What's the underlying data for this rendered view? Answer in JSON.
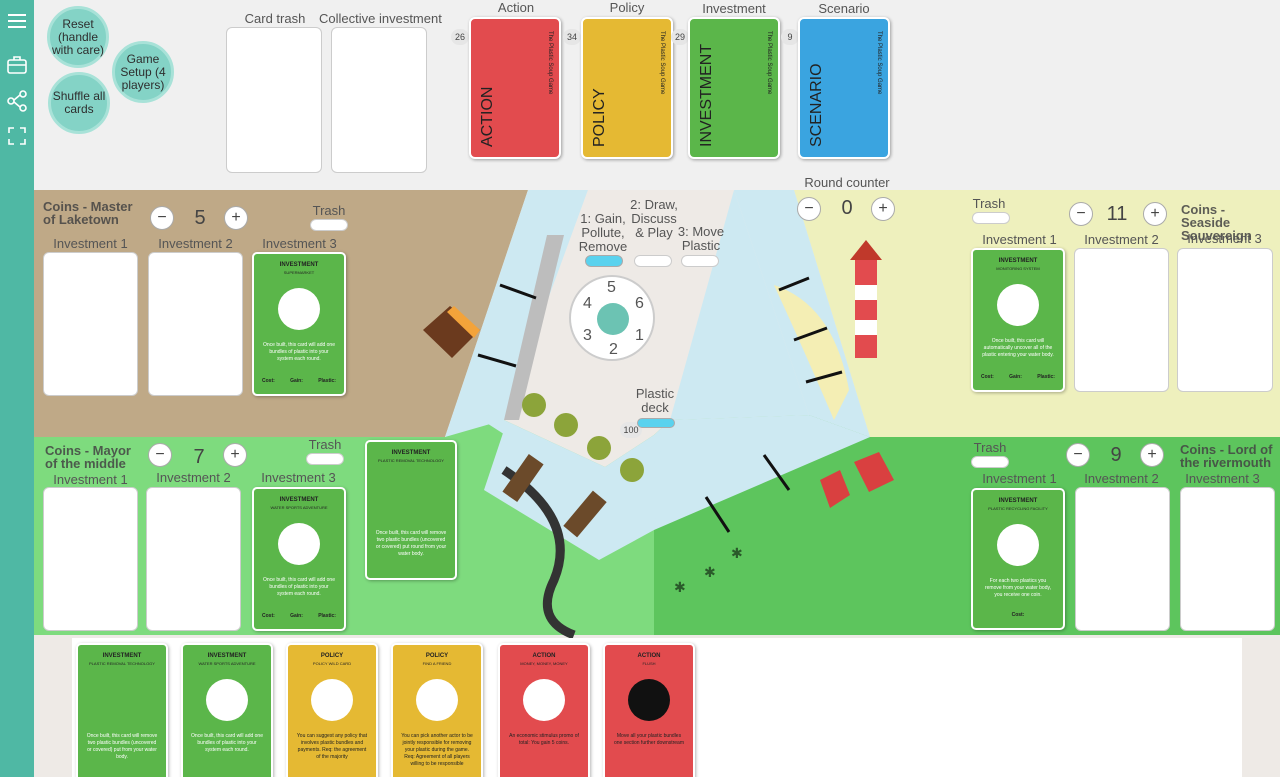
{
  "sidebar": {
    "icons": [
      "menu-icon",
      "briefcase-icon",
      "share-icon",
      "fullscreen-icon"
    ]
  },
  "controls": {
    "reset": "Reset (handle with care)",
    "setup": "Game Setup (4 players)",
    "shuffle": "Shuffle all cards"
  },
  "topbar": {
    "card_trash": "Card trash",
    "collective": "Collective investment"
  },
  "decks": [
    {
      "header": "Action",
      "name": "ACTION",
      "sub": "The Plastic Soup Game",
      "count": "26",
      "color": "#e24b4e"
    },
    {
      "header": "Policy",
      "name": "POLICY",
      "sub": "The Plastic Soup Game",
      "count": "34",
      "color": "#e5b933"
    },
    {
      "header": "Investment",
      "name": "INVESTMENT",
      "sub": "The Plastic Soup Game",
      "count": "29",
      "color": "#5bb64a"
    },
    {
      "header": "Scenario",
      "name": "SCENARIO",
      "sub": "The Plastic Soup Game",
      "count": "9",
      "color": "#3aa4e0"
    }
  ],
  "round": {
    "label": "Round counter",
    "value": "0",
    "minus": "−",
    "plus": "+"
  },
  "phases": [
    {
      "label": "1: Gain, Pollute, Remove",
      "active": true
    },
    {
      "label": "2: Draw, Discuss & Play",
      "active": false
    },
    {
      "label": "3: Move Plastic",
      "active": false
    }
  ],
  "dial": [
    "5",
    "6",
    "1",
    "2",
    "3",
    "4"
  ],
  "plastic": {
    "label": "Plastic deck",
    "count": "100"
  },
  "players": {
    "laketown": {
      "name": "Coins - Master of Laketown",
      "coins": "5",
      "trash": "Trash",
      "inv": [
        "Investment 1",
        "Investment 2",
        "Investment 3"
      ]
    },
    "seaside": {
      "name": "Coins - Seaside Souvereign",
      "coins": "11",
      "trash": "Trash",
      "inv": [
        "Investment 1",
        "Investment 2",
        "Investment 3"
      ]
    },
    "middle": {
      "name": "Coins - Mayor of the middle",
      "coins": "7",
      "trash": "Trash",
      "inv": [
        "Investment 1",
        "Investment 2",
        "Investment 3"
      ]
    },
    "river": {
      "name": "Coins - Lord of the rivermouth",
      "coins": "9",
      "trash": "Trash",
      "inv": [
        "Investment 1",
        "Investment 2",
        "Investment 3"
      ]
    }
  },
  "board_cards": {
    "supermarket": {
      "type": "INVESTMENT",
      "title": "SUPERMARKET",
      "desc": "Once built, this card will add one bundles of plastic into your system each round.",
      "cost": "Cost:",
      "gain": "Gain:",
      "plastic": "Plastic:"
    },
    "monitoring": {
      "type": "INVESTMENT",
      "title": "MONITORING SYSTEM",
      "desc": "Once built, this card will automatically uncover all of the plastic entering your water body.",
      "cost": "Cost:",
      "gain": "Gain:",
      "plastic": "Plastic:"
    },
    "watersports": {
      "type": "INVESTMENT",
      "title": "WATER SPORTS ADVENTURE",
      "desc": "Once built, this card will add one bundles of plastic into your system each round.",
      "cost": "Cost:",
      "gain": "Gain:",
      "plastic": "Plastic:"
    },
    "removal": {
      "type": "INVESTMENT",
      "title": "PLASTIC REMOVAL TECHNOLOGY",
      "desc": "Once built, this card will remove two plastic bundles (uncovered or covered) put round from your water body."
    },
    "recycling": {
      "type": "INVESTMENT",
      "title": "PLASTIC RECYCLING FACILITY",
      "desc": "For each two plastics you remove from your water body, you receive one coin.",
      "cost": "Cost:"
    }
  },
  "hand": [
    {
      "type": "INVESTMENT",
      "title": "PLASTIC REMOVAL TECHNOLOGY",
      "desc": "Once built, this card will remove two plastic bundles (uncovered or covered) put from your water body.",
      "color": "#5bb64a",
      "footer": [
        "Cost:",
        "Gain:",
        "Plastic:"
      ]
    },
    {
      "type": "INVESTMENT",
      "title": "WATER SPORTS ADVENTURE",
      "desc": "Once built, this card will add one bundles of plastic into your system each round.",
      "color": "#5bb64a",
      "footer": [
        "Cost:",
        "Gain:",
        "Plastic:"
      ]
    },
    {
      "type": "POLICY",
      "title": "POLICY WILD CARD",
      "desc": "You can suggest any policy that involves plastic bundles and payments. Req: the agreement of the majority",
      "color": "#e5b933",
      "footer": []
    },
    {
      "type": "POLICY",
      "title": "FIND A FRIEND",
      "desc": "You can pick another actor to be jointly responsible for removing your plastic during the game. Req: Agreement of all players willing to be responsible",
      "color": "#e5b933",
      "footer": []
    },
    {
      "type": "ACTION",
      "title": "MONEY, MONEY, MONEY",
      "desc": "An economic stimulus promo of total: You gain 5 coins.",
      "color": "#e24b4e",
      "footer": [
        "Cost:"
      ]
    },
    {
      "type": "ACTION",
      "title": "FLUSH",
      "desc": "Move all your plastic bundles one section further downstream",
      "color": "#e24b4e",
      "footer": []
    }
  ]
}
